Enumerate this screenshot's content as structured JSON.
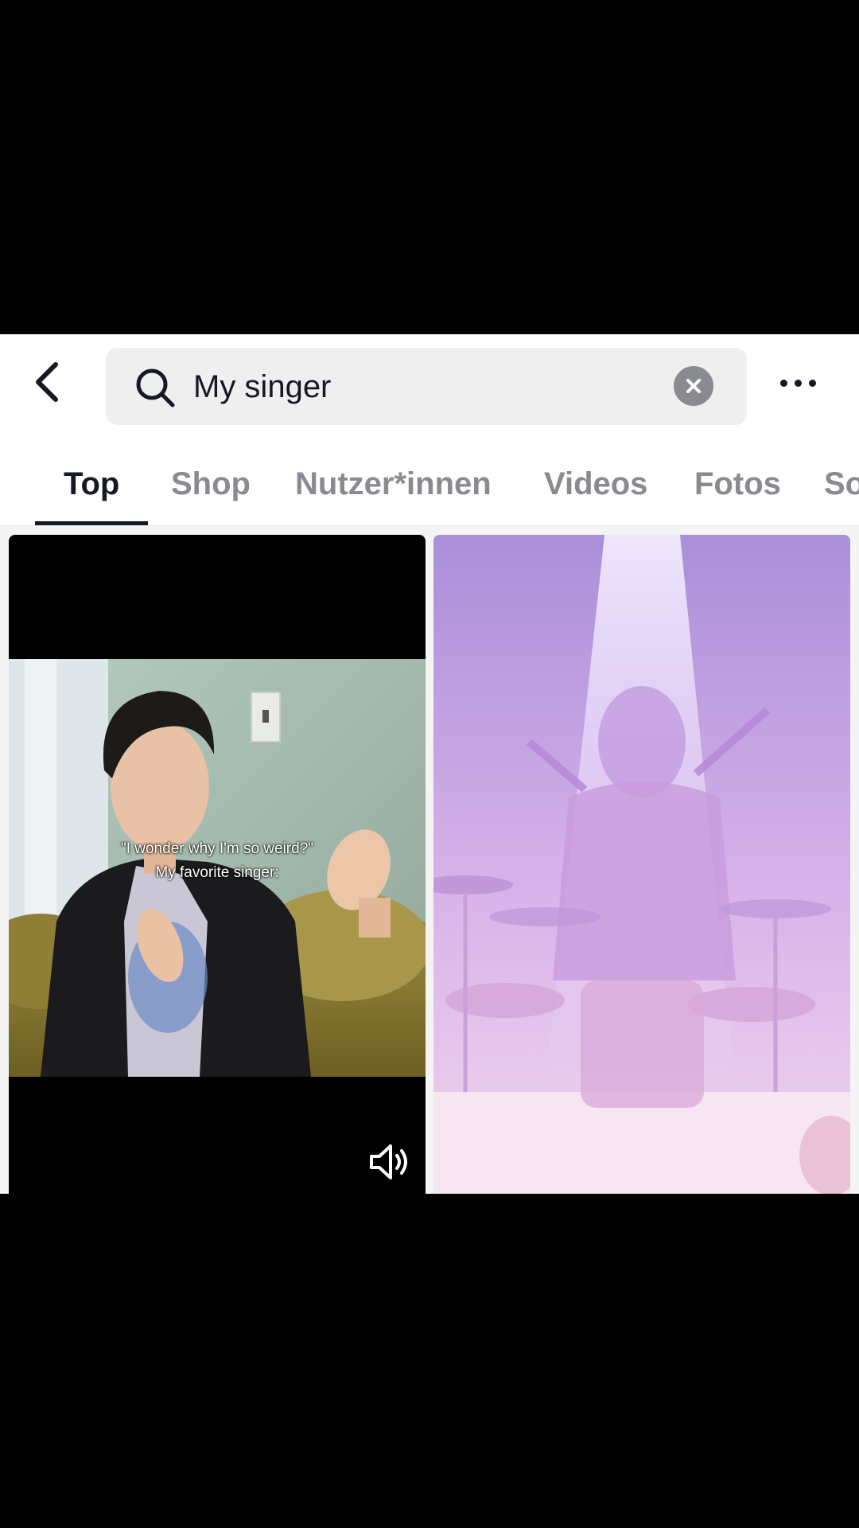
{
  "search": {
    "query": "My singer"
  },
  "tabs": [
    {
      "label": "Top",
      "active": true
    },
    {
      "label": "Shop",
      "active": false
    },
    {
      "label": "Nutzer*innen",
      "active": false
    },
    {
      "label": "Videos",
      "active": false
    },
    {
      "label": "Fotos",
      "active": false
    },
    {
      "label": "So",
      "active": false
    }
  ],
  "results": [
    {
      "caption_line1": "\"I wonder why I'm so weird?\"",
      "caption_line2": "My favorite singer:",
      "sound_icon": "speaker-icon"
    },
    {
      "image": "stage-drummer-pink-light"
    }
  ],
  "icons": {
    "back": "chevron-left-icon",
    "search": "search-icon",
    "clear": "close-circle-icon",
    "more": "more-horizontal-icon"
  },
  "colors": {
    "text_primary": "#161823",
    "text_secondary": "#8a8b91",
    "search_bg": "#efeff0"
  }
}
